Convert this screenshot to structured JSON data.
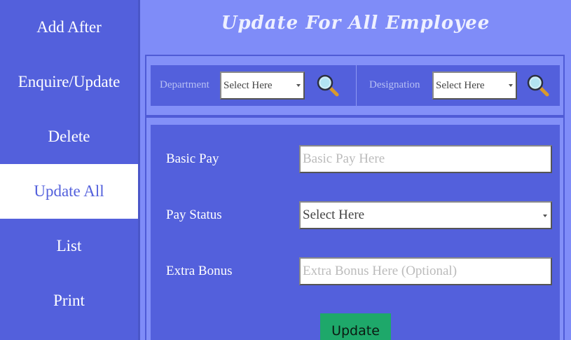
{
  "sidebar": {
    "items": [
      {
        "label": "Add After"
      },
      {
        "label": "Enquire/Update"
      },
      {
        "label": "Delete"
      },
      {
        "label": "Update All",
        "active": true
      },
      {
        "label": "List"
      },
      {
        "label": "Print"
      }
    ]
  },
  "header": {
    "title": "Update For All Employee"
  },
  "filters": {
    "department": {
      "label": "Department",
      "value": "Select Here",
      "search_icon": "magnifier-icon"
    },
    "designation": {
      "label": "Designation",
      "value": "Select Here",
      "search_icon": "magnifier-icon"
    }
  },
  "form": {
    "basic_pay": {
      "label": "Basic Pay",
      "placeholder": "Basic Pay Here"
    },
    "pay_status": {
      "label": "Pay Status",
      "value": "Select Here"
    },
    "extra_bonus": {
      "label": "Extra Bonus",
      "placeholder": "Extra Bonus Here (Optional)"
    },
    "submit_label": "Update"
  },
  "colors": {
    "sidebar_bg": "#5360dc",
    "page_bg": "#7f8cf8",
    "active_item_bg": "#ffffff",
    "button_bg": "#1ea86a"
  }
}
